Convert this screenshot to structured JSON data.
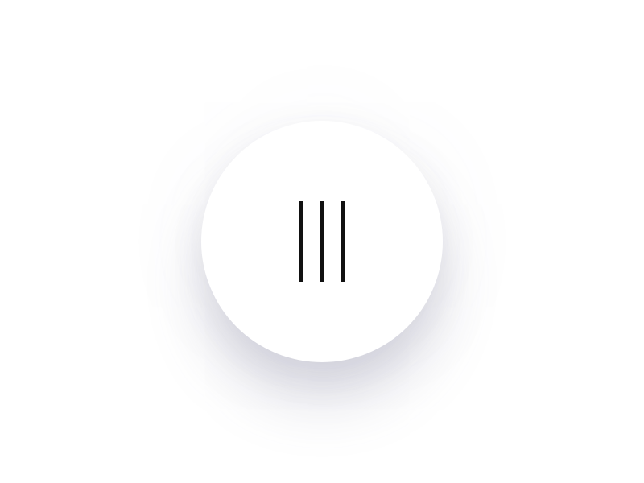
{
  "menu_button": {
    "icon": "vertical-bars-menu-icon",
    "bar_count": 3
  },
  "colors": {
    "background": "#ffffff",
    "button": "#ffffff",
    "icon": "#111111"
  }
}
